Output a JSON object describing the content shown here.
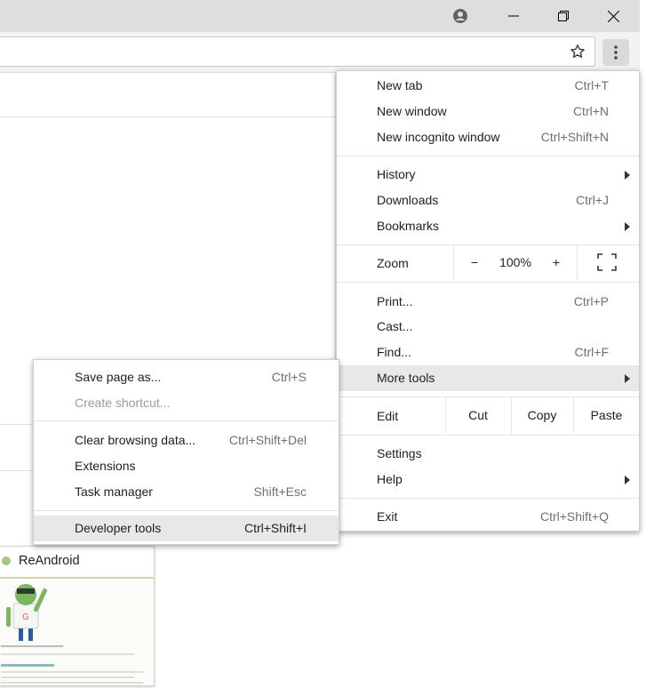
{
  "menu": {
    "new_tab": "New tab",
    "new_tab_sc": "Ctrl+T",
    "new_window": "New window",
    "new_window_sc": "Ctrl+N",
    "new_incognito": "New incognito window",
    "new_incognito_sc": "Ctrl+Shift+N",
    "history": "History",
    "downloads": "Downloads",
    "downloads_sc": "Ctrl+J",
    "bookmarks": "Bookmarks",
    "zoom": "Zoom",
    "zoom_minus": "−",
    "zoom_value": "100%",
    "zoom_plus": "+",
    "print": "Print...",
    "print_sc": "Ctrl+P",
    "cast": "Cast...",
    "find": "Find...",
    "find_sc": "Ctrl+F",
    "more_tools": "More tools",
    "edit": "Edit",
    "cut": "Cut",
    "copy": "Copy",
    "paste": "Paste",
    "settings": "Settings",
    "help": "Help",
    "exit": "Exit",
    "exit_sc": "Ctrl+Shift+Q"
  },
  "submenu": {
    "save_page": "Save page as...",
    "save_page_sc": "Ctrl+S",
    "create_shortcut": "Create shortcut...",
    "clear_browsing": "Clear browsing data...",
    "clear_browsing_sc": "Ctrl+Shift+Del",
    "extensions": "Extensions",
    "task_manager": "Task manager",
    "task_manager_sc": "Shift+Esc",
    "developer_tools": "Developer tools",
    "developer_tools_sc": "Ctrl+Shift+I"
  },
  "thumbnail": {
    "title": "ReAndroid"
  },
  "icons": {
    "profile": "profile-icon",
    "minimize": "minimize-icon",
    "restore": "restore-icon",
    "close": "close-icon",
    "star": "star-icon",
    "menu": "kebab-menu-icon",
    "fullscreen": "fullscreen-icon",
    "submenu_arrow": "chevron-right-icon"
  },
  "colors": {
    "highlight": "#e8e8e8",
    "titlebar": "#dedede",
    "toolbar": "#f2f2f2"
  }
}
